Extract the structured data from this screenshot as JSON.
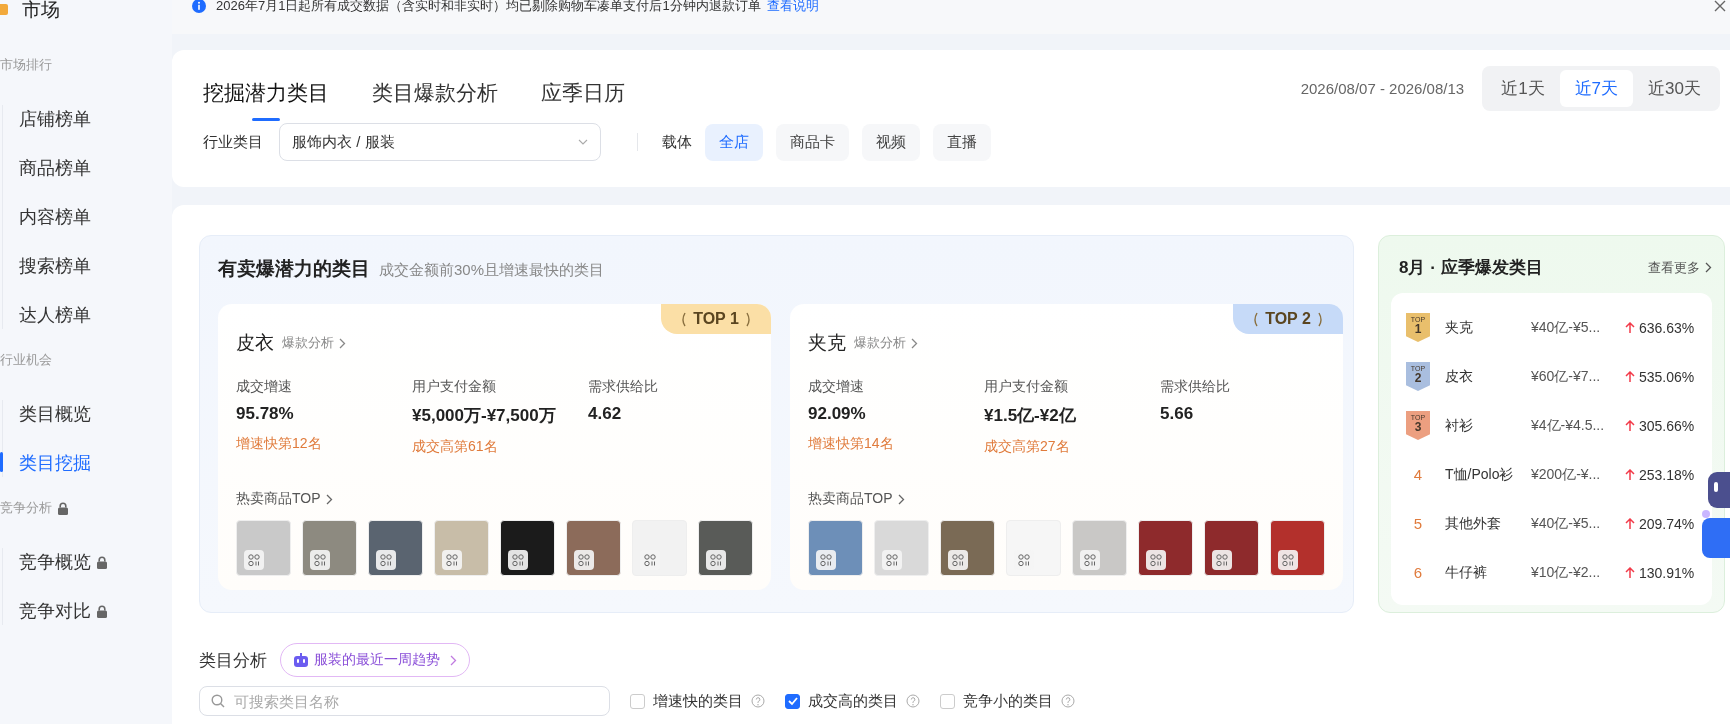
{
  "sidebar": {
    "title": "市场",
    "sections": [
      {
        "label": "市场排行",
        "locked": false,
        "items": [
          {
            "label": "店铺榜单",
            "selected": false,
            "locked": false
          },
          {
            "label": "商品榜单",
            "selected": false,
            "locked": false
          },
          {
            "label": "内容榜单",
            "selected": false,
            "locked": false
          },
          {
            "label": "搜索榜单",
            "selected": false,
            "locked": false
          },
          {
            "label": "达人榜单",
            "selected": false,
            "locked": false
          }
        ]
      },
      {
        "label": "行业机会",
        "locked": false,
        "items": [
          {
            "label": "类目概览",
            "selected": false,
            "locked": false
          },
          {
            "label": "类目挖掘",
            "selected": true,
            "locked": false
          }
        ]
      },
      {
        "label": "竞争分析",
        "locked": true,
        "items": [
          {
            "label": "竞争概览",
            "selected": false,
            "locked": true
          },
          {
            "label": "竞争对比",
            "selected": false,
            "locked": true
          }
        ]
      }
    ]
  },
  "notice": {
    "text": "2026年7月1日起所有成交数据（含实时和非实时）均已剔除购物车凑单支付后1分钟内退款订单",
    "link": "查看说明"
  },
  "tabs": [
    {
      "label": "挖掘潜力类目",
      "selected": true
    },
    {
      "label": "类目爆款分析",
      "selected": false
    },
    {
      "label": "应季日历",
      "selected": false
    }
  ],
  "date_range": "2026/08/07 - 2026/08/13",
  "periods": [
    {
      "label": "近1天",
      "selected": false
    },
    {
      "label": "近7天",
      "selected": true
    },
    {
      "label": "近30天",
      "selected": false
    }
  ],
  "industry": {
    "label": "行业类目",
    "value": "服饰内衣 / 服装"
  },
  "carrier": {
    "label": "载体",
    "options": [
      {
        "label": "全店",
        "selected": true
      },
      {
        "label": "商品卡",
        "selected": false
      },
      {
        "label": "视频",
        "selected": false
      },
      {
        "label": "直播",
        "selected": false
      }
    ]
  },
  "potential": {
    "title": "有卖爆潜力的类目",
    "subtitle": "成交金额前30%且增速最快的类目",
    "cards": [
      {
        "rank_label": "TOP 1",
        "color": "#fbdfa6",
        "name": "皮衣",
        "link": "爆款分析",
        "metrics": [
          {
            "label": "成交增速",
            "value": "95.78%",
            "note": "增速快第12名"
          },
          {
            "label": "用户支付金额",
            "value": "¥5,000万-¥7,500万",
            "note": "成交高第61名"
          },
          {
            "label": "需求供给比",
            "value": "4.62"
          }
        ],
        "hot_label": "热卖商品TOP",
        "products": [
          {
            "kind": "photo"
          },
          {
            "kind": "photo"
          },
          {
            "kind": "photo"
          },
          {
            "kind": "photo"
          },
          {
            "kind": "photo"
          },
          {
            "kind": "photo"
          },
          {
            "kind": "photo"
          },
          {
            "kind": "photo"
          }
        ]
      },
      {
        "rank_label": "TOP 2",
        "color": "#c6daf8",
        "name": "夹克",
        "link": "爆款分析",
        "metrics": [
          {
            "label": "成交增速",
            "value": "92.09%",
            "note": "增速快第14名"
          },
          {
            "label": "用户支付金额",
            "value": "¥1.5亿-¥2亿",
            "note": "成交高第27名"
          },
          {
            "label": "需求供给比",
            "value": "5.66"
          }
        ],
        "hot_label": "热卖商品TOP",
        "products": [
          {
            "kind": "photo"
          },
          {
            "kind": "photo"
          },
          {
            "kind": "photo"
          },
          {
            "kind": "photo"
          },
          {
            "kind": "photo"
          },
          {
            "kind": "photo"
          },
          {
            "kind": "photo"
          },
          {
            "kind": "photo"
          }
        ]
      }
    ]
  },
  "season": {
    "title": "8月 · 应季爆发类目",
    "more": "查看更多",
    "rows": [
      {
        "kind": "medal",
        "badge_label": "TOP",
        "rank": "1",
        "color": "#e9bf6c",
        "category": "夹克",
        "amount": "¥40亿-¥5...",
        "growth": "636.63%"
      },
      {
        "kind": "medal",
        "badge_label": "TOP",
        "rank": "2",
        "color": "#a9bedf",
        "category": "皮衣",
        "amount": "¥60亿-¥7...",
        "growth": "535.06%"
      },
      {
        "kind": "medal",
        "badge_label": "TOP",
        "rank": "3",
        "color": "#ec9f80",
        "category": "衬衫",
        "amount": "¥4亿-¥4.5...",
        "growth": "305.66%"
      },
      {
        "kind": "plain",
        "rank": "4",
        "category": "T恤/Polo衫",
        "amount": "¥200亿-¥...",
        "growth": "253.18%"
      },
      {
        "kind": "plain",
        "rank": "5",
        "category": "其他外套",
        "amount": "¥40亿-¥5...",
        "growth": "209.74%"
      },
      {
        "kind": "plain",
        "rank": "6",
        "category": "牛仔裤",
        "amount": "¥10亿-¥2...",
        "growth": "130.91%"
      }
    ]
  },
  "analysis": {
    "title": "类目分析",
    "trend": "服装的最近一周趋势",
    "search": {
      "placeholder": "可搜索类目名称"
    },
    "filters": [
      {
        "label": "增速快的类目",
        "checked": false
      },
      {
        "label": "成交高的类目",
        "checked": true
      },
      {
        "label": "竞争小的类目",
        "checked": false
      }
    ]
  }
}
